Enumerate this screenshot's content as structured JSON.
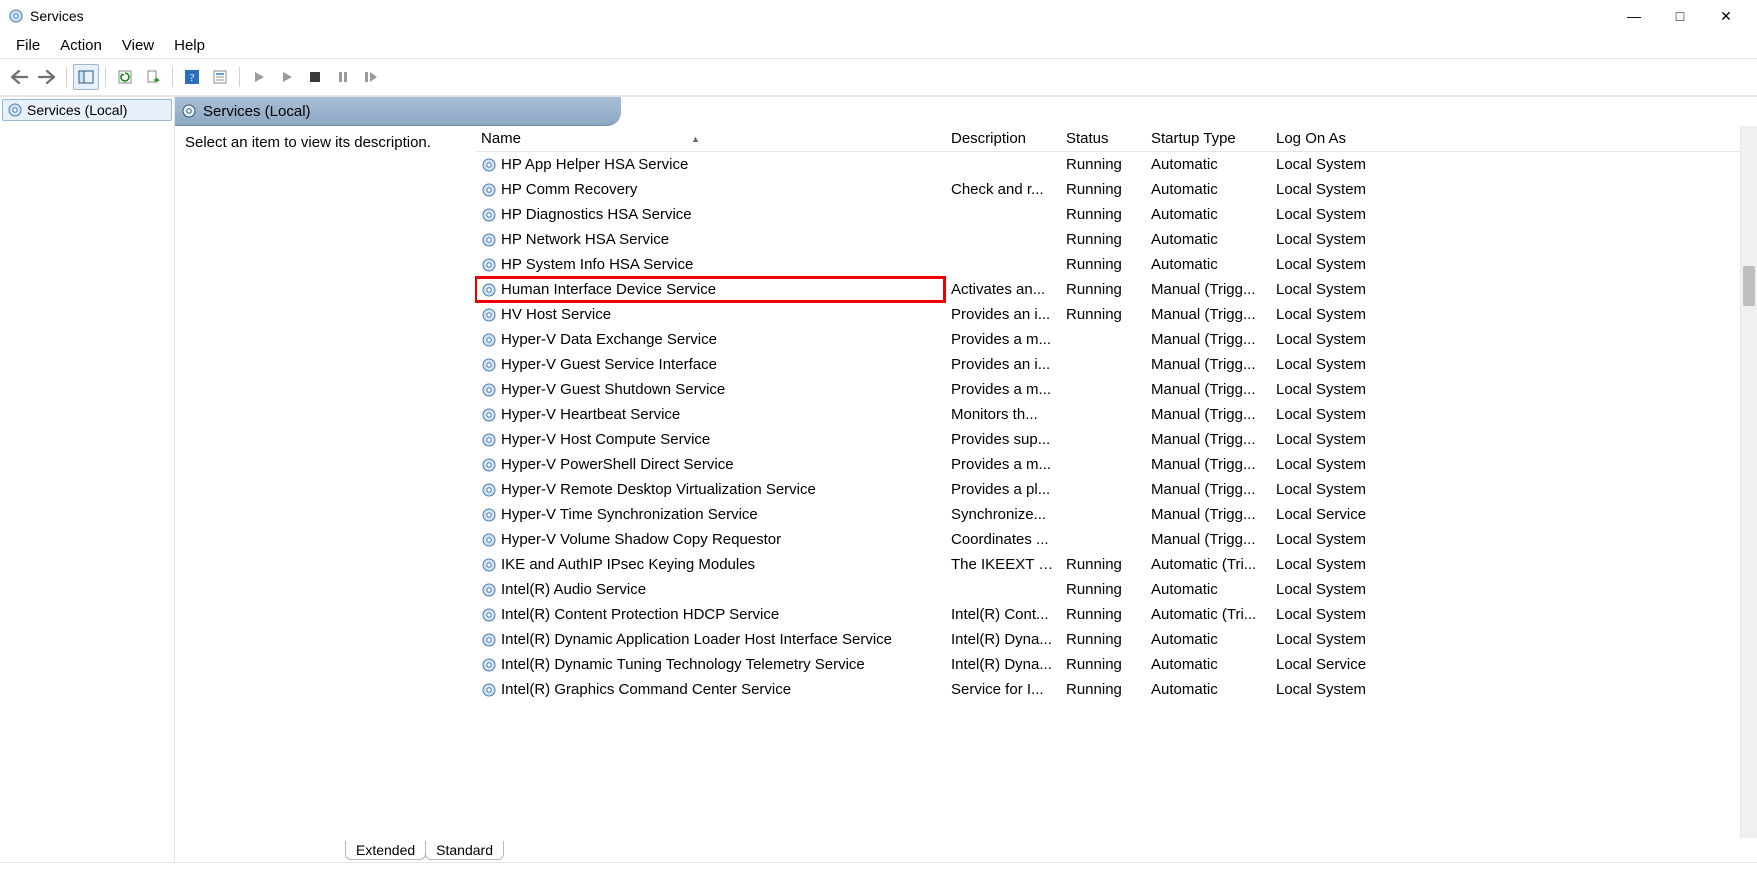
{
  "titlebar": {
    "title": "Services"
  },
  "winbtns": {
    "min": "—",
    "max": "□",
    "close": "✕"
  },
  "menu": {
    "items": [
      "File",
      "Action",
      "View",
      "Help"
    ]
  },
  "tree": {
    "root": "Services (Local)"
  },
  "header": {
    "title": "Services (Local)"
  },
  "descpane": {
    "placeholder": "Select an item to view its description."
  },
  "columns": {
    "name": "Name",
    "desc": "Description",
    "status": "Status",
    "startup": "Startup Type",
    "logon": "Log On As"
  },
  "services": [
    {
      "name": "HP App Helper HSA Service",
      "desc": "",
      "status": "Running",
      "startup": "Automatic",
      "logon": "Local System",
      "hi": false
    },
    {
      "name": "HP Comm Recovery",
      "desc": "Check and r...",
      "status": "Running",
      "startup": "Automatic",
      "logon": "Local System",
      "hi": false
    },
    {
      "name": "HP Diagnostics HSA Service",
      "desc": "",
      "status": "Running",
      "startup": "Automatic",
      "logon": "Local System",
      "hi": false
    },
    {
      "name": "HP Network HSA Service",
      "desc": "",
      "status": "Running",
      "startup": "Automatic",
      "logon": "Local System",
      "hi": false
    },
    {
      "name": "HP System Info HSA Service",
      "desc": "",
      "status": "Running",
      "startup": "Automatic",
      "logon": "Local System",
      "hi": false
    },
    {
      "name": "Human Interface Device Service",
      "desc": "Activates an...",
      "status": "Running",
      "startup": "Manual (Trigg...",
      "logon": "Local System",
      "hi": true
    },
    {
      "name": "HV Host Service",
      "desc": "Provides an i...",
      "status": "Running",
      "startup": "Manual (Trigg...",
      "logon": "Local System",
      "hi": false
    },
    {
      "name": "Hyper-V Data Exchange Service",
      "desc": "Provides a m...",
      "status": "",
      "startup": "Manual (Trigg...",
      "logon": "Local System",
      "hi": false
    },
    {
      "name": "Hyper-V Guest Service Interface",
      "desc": "Provides an i...",
      "status": "",
      "startup": "Manual (Trigg...",
      "logon": "Local System",
      "hi": false
    },
    {
      "name": "Hyper-V Guest Shutdown Service",
      "desc": "Provides a m...",
      "status": "",
      "startup": "Manual (Trigg...",
      "logon": "Local System",
      "hi": false
    },
    {
      "name": "Hyper-V Heartbeat Service",
      "desc": "Monitors th...",
      "status": "",
      "startup": "Manual (Trigg...",
      "logon": "Local System",
      "hi": false
    },
    {
      "name": "Hyper-V Host Compute Service",
      "desc": "Provides sup...",
      "status": "",
      "startup": "Manual (Trigg...",
      "logon": "Local System",
      "hi": false
    },
    {
      "name": "Hyper-V PowerShell Direct Service",
      "desc": "Provides a m...",
      "status": "",
      "startup": "Manual (Trigg...",
      "logon": "Local System",
      "hi": false
    },
    {
      "name": "Hyper-V Remote Desktop Virtualization Service",
      "desc": "Provides a pl...",
      "status": "",
      "startup": "Manual (Trigg...",
      "logon": "Local System",
      "hi": false
    },
    {
      "name": "Hyper-V Time Synchronization Service",
      "desc": "Synchronize...",
      "status": "",
      "startup": "Manual (Trigg...",
      "logon": "Local Service",
      "hi": false
    },
    {
      "name": "Hyper-V Volume Shadow Copy Requestor",
      "desc": "Coordinates ...",
      "status": "",
      "startup": "Manual (Trigg...",
      "logon": "Local System",
      "hi": false
    },
    {
      "name": "IKE and AuthIP IPsec Keying Modules",
      "desc": "The IKEEXT s...",
      "status": "Running",
      "startup": "Automatic (Tri...",
      "logon": "Local System",
      "hi": false
    },
    {
      "name": "Intel(R) Audio Service",
      "desc": "",
      "status": "Running",
      "startup": "Automatic",
      "logon": "Local System",
      "hi": false
    },
    {
      "name": "Intel(R) Content Protection HDCP Service",
      "desc": "Intel(R) Cont...",
      "status": "Running",
      "startup": "Automatic (Tri...",
      "logon": "Local System",
      "hi": false
    },
    {
      "name": "Intel(R) Dynamic Application Loader Host Interface Service",
      "desc": "Intel(R) Dyna...",
      "status": "Running",
      "startup": "Automatic",
      "logon": "Local System",
      "hi": false
    },
    {
      "name": "Intel(R) Dynamic Tuning Technology Telemetry Service",
      "desc": "Intel(R) Dyna...",
      "status": "Running",
      "startup": "Automatic",
      "logon": "Local Service",
      "hi": false
    },
    {
      "name": "Intel(R) Graphics Command Center Service",
      "desc": "Service for I...",
      "status": "Running",
      "startup": "Automatic",
      "logon": "Local System",
      "hi": false
    }
  ],
  "tabs": {
    "extended": "Extended",
    "standard": "Standard"
  }
}
